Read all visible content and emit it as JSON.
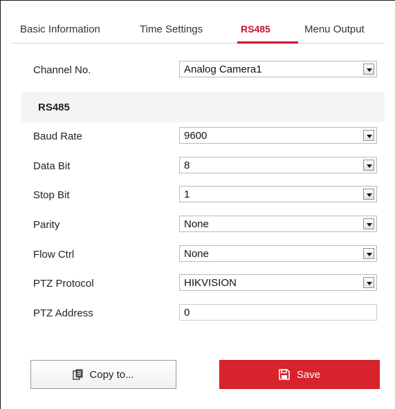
{
  "tabs": [
    {
      "label": "Basic Information"
    },
    {
      "label": "Time Settings"
    },
    {
      "label": "RS485"
    },
    {
      "label": "Menu Output"
    }
  ],
  "active_tab": "RS485",
  "channel": {
    "label": "Channel No.",
    "value": "Analog Camera1"
  },
  "section": {
    "title": "RS485"
  },
  "fields": {
    "baud_rate": {
      "label": "Baud Rate",
      "value": "9600"
    },
    "data_bit": {
      "label": "Data Bit",
      "value": "8"
    },
    "stop_bit": {
      "label": "Stop Bit",
      "value": "1"
    },
    "parity": {
      "label": "Parity",
      "value": "None"
    },
    "flow_ctrl": {
      "label": "Flow Ctrl",
      "value": "None"
    },
    "ptz_protocol": {
      "label": "PTZ Protocol",
      "value": "HIKVISION"
    },
    "ptz_address": {
      "label": "PTZ Address",
      "value": "0"
    }
  },
  "buttons": {
    "copy_label": "Copy to...",
    "save_label": "Save"
  },
  "icons": {
    "copy": "copy-icon",
    "save": "save-icon"
  },
  "colors": {
    "accent": "#c8102e",
    "save_button": "#d9232c"
  }
}
